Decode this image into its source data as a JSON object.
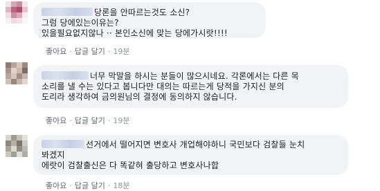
{
  "comments": [
    {
      "lines": [
        "당론을 안따르는것도 소신?",
        "그럼 당에있는이유는?",
        "있을필요없지않나 ·· 본인소신에 맞는 당에가시랏!!!!"
      ],
      "actions": {
        "like": "좋아요",
        "reply": "답글 달기",
        "time": "19분"
      }
    },
    {
      "lines": [
        "너무 막말을 하시는 분들이 많으시네요. 각론에서는 다른 목",
        "소리를 낼 수는 있다고 봅니다만 대의는 따르는게 당적을 가지신 분의",
        "도리라 생각하여 금의원님의 결정에 동의하지 않습니다."
      ],
      "actions": {
        "like": "좋아요",
        "reply": "답글 달기",
        "time": "19분"
      }
    },
    {
      "lines": [
        "선거에서 떨어지면 변호사 개업해야하니 국민보다 검찰들 눈치",
        "봐겠지",
        "에랏이 검찰출신은 다 똑같혀 출당하고 변호사나합"
      ],
      "actions": {
        "like": "좋아요",
        "reply": "답글 달기",
        "time": "18분"
      }
    }
  ],
  "colors": {
    "bubble": "#f2f3f5",
    "action_text": "#606770",
    "time_text": "#90949c"
  }
}
